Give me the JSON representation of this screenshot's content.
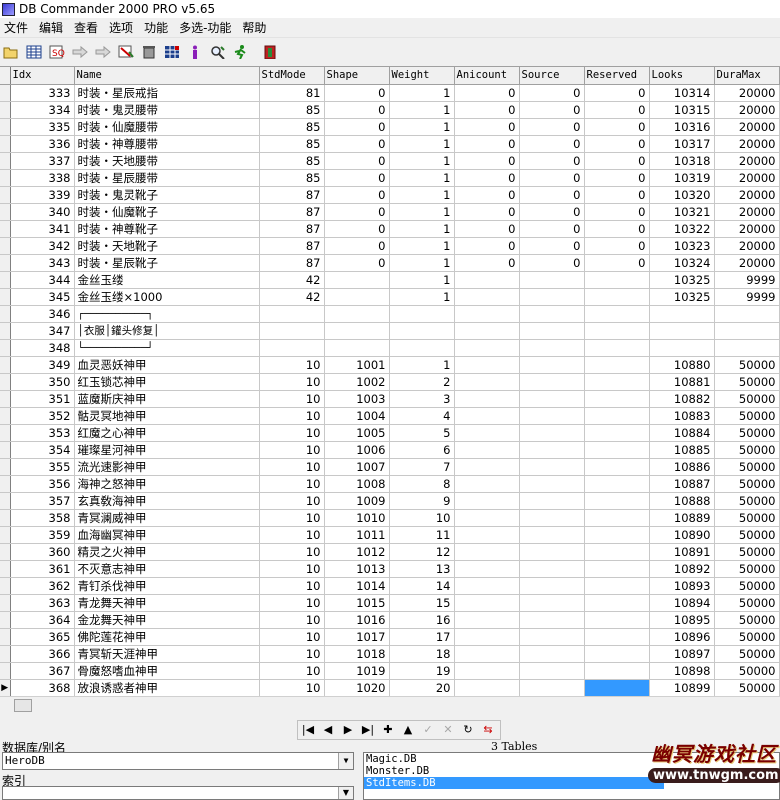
{
  "window": {
    "title": "DB Commander 2000 PRO v5.65"
  },
  "menu": [
    "文件",
    "编辑",
    "查看",
    "选项",
    "功能",
    "多选-功能",
    "帮助"
  ],
  "toolbar": [
    "open-icon",
    "table-icon",
    "query-icon",
    "arrow-right-icon",
    "export-icon",
    "filter-icon",
    "delete-icon",
    "grid-icon",
    "info-icon",
    "search-icon",
    "run-icon",
    "exit-icon"
  ],
  "columns": [
    "Idx",
    "Name",
    "StdMode",
    "Shape",
    "Weight",
    "Anicount",
    "Source",
    "Reserved",
    "Looks",
    "DuraMax"
  ],
  "rows": [
    [
      "333",
      "时装・星辰戒指",
      "81",
      "0",
      "1",
      "0",
      "0",
      "0",
      "10314",
      "20000"
    ],
    [
      "334",
      "时装・鬼灵腰带",
      "85",
      "0",
      "1",
      "0",
      "0",
      "0",
      "10315",
      "20000"
    ],
    [
      "335",
      "时装・仙魔腰带",
      "85",
      "0",
      "1",
      "0",
      "0",
      "0",
      "10316",
      "20000"
    ],
    [
      "336",
      "时装・神尊腰带",
      "85",
      "0",
      "1",
      "0",
      "0",
      "0",
      "10317",
      "20000"
    ],
    [
      "337",
      "时装・天地腰带",
      "85",
      "0",
      "1",
      "0",
      "0",
      "0",
      "10318",
      "20000"
    ],
    [
      "338",
      "时装・星辰腰带",
      "85",
      "0",
      "1",
      "0",
      "0",
      "0",
      "10319",
      "20000"
    ],
    [
      "339",
      "时装・鬼灵靴子",
      "87",
      "0",
      "1",
      "0",
      "0",
      "0",
      "10320",
      "20000"
    ],
    [
      "340",
      "时装・仙魔靴子",
      "87",
      "0",
      "1",
      "0",
      "0",
      "0",
      "10321",
      "20000"
    ],
    [
      "341",
      "时装・神尊靴子",
      "87",
      "0",
      "1",
      "0",
      "0",
      "0",
      "10322",
      "20000"
    ],
    [
      "342",
      "时装・天地靴子",
      "87",
      "0",
      "1",
      "0",
      "0",
      "0",
      "10323",
      "20000"
    ],
    [
      "343",
      "时装・星辰靴子",
      "87",
      "0",
      "1",
      "0",
      "0",
      "0",
      "10324",
      "20000"
    ],
    [
      "344",
      "金丝玉缕",
      "42",
      "",
      "1",
      "",
      "",
      "",
      "10325",
      "9999"
    ],
    [
      "345",
      "金丝玉缕×1000",
      "42",
      "",
      "1",
      "",
      "",
      "",
      "10325",
      "9999"
    ],
    [
      "346",
      "┌──────────┐",
      "",
      "",
      "",
      "",
      "",
      "",
      "",
      ""
    ],
    [
      "347",
      "│衣服│鑵头修复│",
      "",
      "",
      "",
      "",
      "",
      "",
      "",
      ""
    ],
    [
      "348",
      "└──────────┘",
      "",
      "",
      "",
      "",
      "",
      "",
      "",
      ""
    ],
    [
      "349",
      "血灵恶妖神甲",
      "10",
      "1001",
      "1",
      "",
      "",
      "",
      "10880",
      "50000"
    ],
    [
      "350",
      "红玉锁芯神甲",
      "10",
      "1002",
      "2",
      "",
      "",
      "",
      "10881",
      "50000"
    ],
    [
      "351",
      "蓝魔斯庆神甲",
      "10",
      "1003",
      "3",
      "",
      "",
      "",
      "10882",
      "50000"
    ],
    [
      "352",
      "骷灵冥地神甲",
      "10",
      "1004",
      "4",
      "",
      "",
      "",
      "10883",
      "50000"
    ],
    [
      "353",
      "红魔之心神甲",
      "10",
      "1005",
      "5",
      "",
      "",
      "",
      "10884",
      "50000"
    ],
    [
      "354",
      "璀璨星河神甲",
      "10",
      "1006",
      "6",
      "",
      "",
      "",
      "10885",
      "50000"
    ],
    [
      "355",
      "流光速影神甲",
      "10",
      "1007",
      "7",
      "",
      "",
      "",
      "10886",
      "50000"
    ],
    [
      "356",
      "海神之怒神甲",
      "10",
      "1008",
      "8",
      "",
      "",
      "",
      "10887",
      "50000"
    ],
    [
      "357",
      "玄真敎海神甲",
      "10",
      "1009",
      "9",
      "",
      "",
      "",
      "10888",
      "50000"
    ],
    [
      "358",
      "青冥澜威神甲",
      "10",
      "1010",
      "10",
      "",
      "",
      "",
      "10889",
      "50000"
    ],
    [
      "359",
      "血海幽冥神甲",
      "10",
      "1011",
      "11",
      "",
      "",
      "",
      "10890",
      "50000"
    ],
    [
      "360",
      "精灵之火神甲",
      "10",
      "1012",
      "12",
      "",
      "",
      "",
      "10891",
      "50000"
    ],
    [
      "361",
      "不灭意志神甲",
      "10",
      "1013",
      "13",
      "",
      "",
      "",
      "10892",
      "50000"
    ],
    [
      "362",
      "青钉杀伐神甲",
      "10",
      "1014",
      "14",
      "",
      "",
      "",
      "10893",
      "50000"
    ],
    [
      "363",
      "青龙舞天神甲",
      "10",
      "1015",
      "15",
      "",
      "",
      "",
      "10894",
      "50000"
    ],
    [
      "364",
      "金龙舞天神甲",
      "10",
      "1016",
      "16",
      "",
      "",
      "",
      "10895",
      "50000"
    ],
    [
      "365",
      "佛陀莲花神甲",
      "10",
      "1017",
      "17",
      "",
      "",
      "",
      "10896",
      "50000"
    ],
    [
      "366",
      "青冥斩天涯神甲",
      "10",
      "1018",
      "18",
      "",
      "",
      "",
      "10897",
      "50000"
    ],
    [
      "367",
      "骨魔怒嗜血神甲",
      "10",
      "1019",
      "19",
      "",
      "",
      "",
      "10898",
      "50000"
    ],
    [
      "368",
      "放浪诱惑者神甲",
      "10",
      "1020",
      "20",
      "",
      "",
      "",
      "10899",
      "50000"
    ]
  ],
  "navigator": [
    "first-icon",
    "prior-icon",
    "next-icon",
    "last-icon",
    "insert-icon",
    "delete-icon",
    "post-icon",
    "cancel-icon",
    "refresh-icon",
    "filter-icon"
  ],
  "db_label": "数据库/别名",
  "db_value": "HeroDB",
  "index_label": "索引",
  "tables_count": "3 Tables",
  "tables": [
    "Magic.DB",
    "Monster.DB",
    "StdItems.DB"
  ],
  "watermark": {
    "title": "幽冥游戏社区",
    "url": "www.tnwgm.com"
  },
  "colors": {
    "selection": "#3399ff",
    "window": "#f0f0f0"
  }
}
